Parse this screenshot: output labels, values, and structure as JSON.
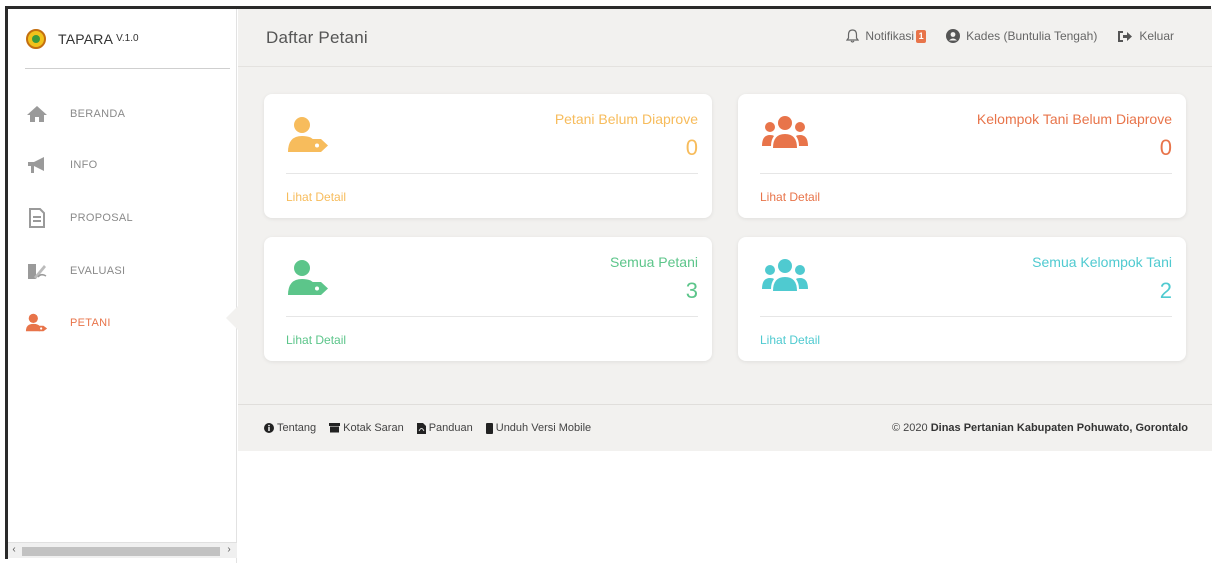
{
  "brand": {
    "name": "TAPARA",
    "version": "V.1.0"
  },
  "sidebar": {
    "items": [
      {
        "label": "BERANDA",
        "icon": "home-icon"
      },
      {
        "label": "INFO",
        "icon": "megaphone-icon"
      },
      {
        "label": "PROPOSAL",
        "icon": "document-icon"
      },
      {
        "label": "EVALUASI",
        "icon": "signature-icon"
      },
      {
        "label": "PETANI",
        "icon": "user-tag-icon",
        "active": true
      }
    ]
  },
  "header": {
    "title": "Daftar Petani",
    "notification_label": "Notifikasi",
    "notification_count": "1",
    "user_label": "Kades (Buntulia Tengah)",
    "logout_label": "Keluar"
  },
  "cards": [
    {
      "title": "Petani Belum Diaprove",
      "value": "0",
      "link": "Lihat Detail",
      "color": "#f7bc5c",
      "icon": "user-tag-icon"
    },
    {
      "title": "Kelompok Tani Belum Diaprove",
      "value": "0",
      "link": "Lihat Detail",
      "color": "#e8744a",
      "icon": "users-group-icon"
    },
    {
      "title": "Semua Petani",
      "value": "3",
      "link": "Lihat Detail",
      "color": "#5cc58a",
      "icon": "user-tag-icon"
    },
    {
      "title": "Semua Kelompok Tani",
      "value": "2",
      "link": "Lihat Detail",
      "color": "#4fcad0",
      "icon": "users-group-icon"
    }
  ],
  "footer": {
    "links": [
      {
        "label": "Tentang",
        "icon": "info-circle-icon"
      },
      {
        "label": "Kotak Saran",
        "icon": "inbox-icon"
      },
      {
        "label": "Panduan",
        "icon": "pdf-icon"
      },
      {
        "label": "Unduh Versi Mobile",
        "icon": "mobile-icon"
      }
    ],
    "copyright_prefix": "© 2020",
    "copyright_org": "Dinas Pertanian Kabupaten Pohuwato, Gorontalo"
  },
  "colors": {
    "accent": "#e8744a",
    "background": "#f2f1ef"
  }
}
